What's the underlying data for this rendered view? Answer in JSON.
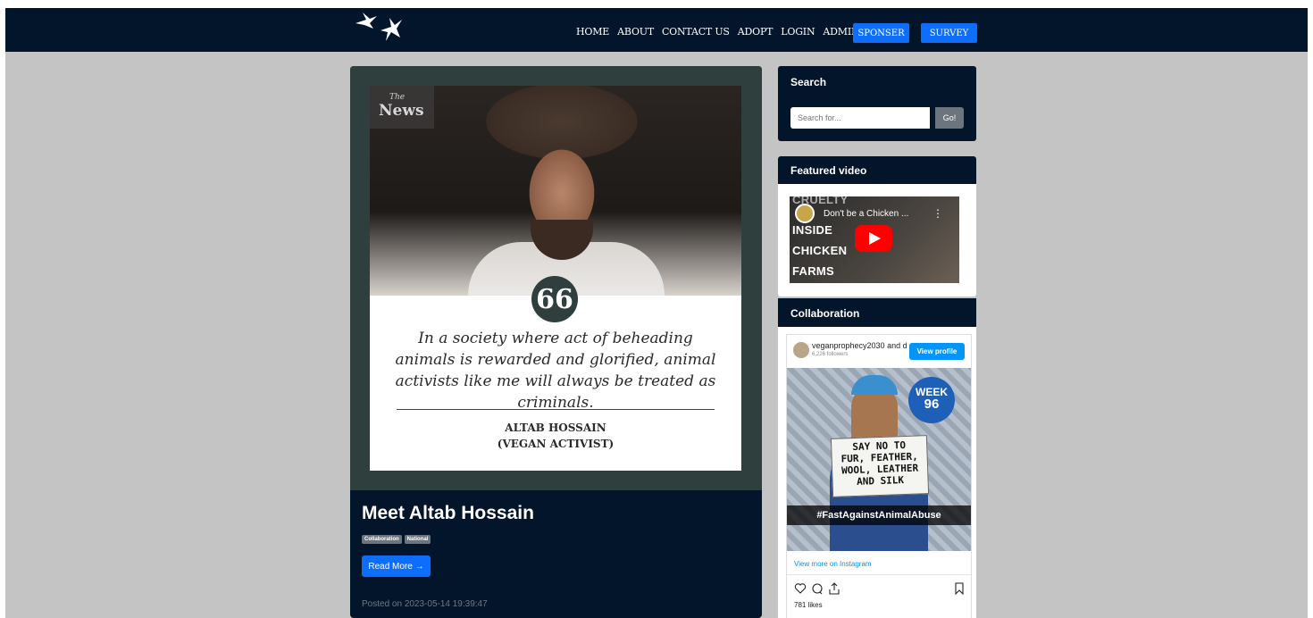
{
  "nav": {
    "links": [
      "HOME",
      "ABOUT",
      "CONTACT US",
      "ADOPT",
      "LOGIN",
      "ADMIN"
    ],
    "sponser_label": "SPONSER",
    "survey_label": "SURVEY"
  },
  "post": {
    "image": {
      "badge_the": "The",
      "badge_news": "News",
      "quote_mark": "66",
      "quote_text": "In a society where act of beheading animals is rewarded and glorified, animal activists like me will always be treated as criminals.",
      "author_name": "ALTAB HOSSAIN",
      "author_role": "(VEGAN ACTIVIST)"
    },
    "title": "Meet Altab Hossain",
    "tags": [
      "Collaboration",
      "National"
    ],
    "read_more": "Read More →",
    "posted": "Posted on 2023-05-14 19:39:47"
  },
  "search": {
    "title": "Search",
    "placeholder": "Search for...",
    "button": "Go!"
  },
  "video": {
    "title": "Featured video",
    "channel_title": "Don't be a Chicken ...",
    "thumb_lines": [
      "CRUELTY",
      "INSIDE",
      "CHICKEN",
      "FARMS"
    ]
  },
  "collab": {
    "title": "Collaboration",
    "insta": {
      "username": "veganprophecy2030 and d",
      "followers": "6,226 followers",
      "view_profile": "View profile",
      "week_label": "WEEK",
      "week_number": "96",
      "sign_lines": [
        "SAY NO TO",
        "FUR, FEATHER,",
        "WOOL, LEATHER",
        "AND SILK"
      ],
      "hashtag": "#FastAgainstAnimalAbuse",
      "view_more": "View more on Instagram",
      "likes": "781 likes"
    }
  },
  "colors": {
    "navbar": "#03152b",
    "accent": "#0d6efd",
    "page_bg": "#c4c4c4"
  },
  "icons": [
    "doves-logo-icon",
    "quote-icon",
    "youtube-play-icon",
    "more-vert-icon",
    "heart-icon",
    "comment-icon",
    "share-icon",
    "bookmark-icon"
  ]
}
